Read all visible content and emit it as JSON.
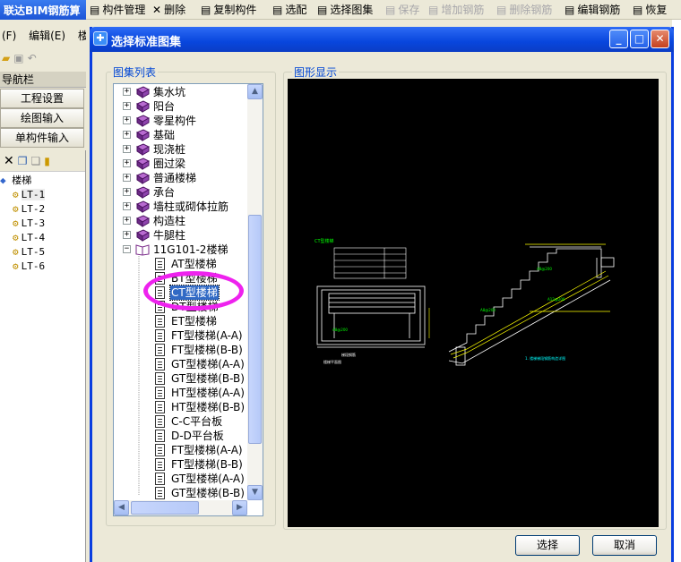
{
  "app": {
    "title": "联达BIM钢筋算",
    "menu": [
      "(F)",
      "编辑(E)",
      "楼"
    ],
    "toolbar": [
      {
        "label": "构件管理",
        "icon": "component-manage-icon",
        "disabled": false
      },
      {
        "label": "删除",
        "icon": "delete-x-icon",
        "disabled": false
      },
      {
        "label": "复制构件",
        "icon": "copy-component-icon",
        "disabled": false
      },
      {
        "label": "选配",
        "icon": "select-config-icon",
        "disabled": false
      },
      {
        "label": "选择图集",
        "icon": "select-atlas-icon",
        "disabled": false
      },
      {
        "label": "保存",
        "icon": "save-icon",
        "disabled": true
      },
      {
        "label": "增加钢筋",
        "icon": "add-rebar-icon",
        "disabled": true
      },
      {
        "label": "删除钢筋",
        "icon": "delete-rebar-icon",
        "disabled": true
      },
      {
        "label": "编辑钢筋",
        "icon": "edit-rebar-icon",
        "disabled": false
      },
      {
        "label": "恢复",
        "icon": "restore-icon",
        "disabled": false
      }
    ],
    "tree_peek": "楼梯",
    "nav_header": "导航栏",
    "nav_buttons": [
      "工程设置",
      "绘图输入",
      "单构件输入"
    ],
    "component_tree": {
      "root": "楼梯",
      "items": [
        "LT-1",
        "LT-2",
        "LT-3",
        "LT-4",
        "LT-5",
        "LT-6"
      ]
    }
  },
  "dialog": {
    "title": "选择标准图集",
    "list_label": "图集列表",
    "preview_label": "图形显示",
    "ok_button": "选择",
    "cancel_button": "取消",
    "tree": [
      {
        "label": "集水坑",
        "type": "book",
        "level": 0,
        "expanded": false
      },
      {
        "label": "阳台",
        "type": "book",
        "level": 0,
        "expanded": false
      },
      {
        "label": "零星构件",
        "type": "book",
        "level": 0,
        "expanded": false
      },
      {
        "label": "基础",
        "type": "book",
        "level": 0,
        "expanded": false
      },
      {
        "label": "现浇桩",
        "type": "book",
        "level": 0,
        "expanded": false
      },
      {
        "label": "圈过梁",
        "type": "book",
        "level": 0,
        "expanded": false
      },
      {
        "label": "普通楼梯",
        "type": "book",
        "level": 0,
        "expanded": false
      },
      {
        "label": "承台",
        "type": "book",
        "level": 0,
        "expanded": false
      },
      {
        "label": "墙柱或砌体拉筋",
        "type": "book",
        "level": 0,
        "expanded": false
      },
      {
        "label": "构造柱",
        "type": "book",
        "level": 0,
        "expanded": false
      },
      {
        "label": "牛腿柱",
        "type": "book",
        "level": 0,
        "expanded": false
      },
      {
        "label": "11G101-2楼梯",
        "type": "book-open",
        "level": 0,
        "expanded": true
      },
      {
        "label": "AT型楼梯",
        "type": "doc",
        "level": 1
      },
      {
        "label": "BT型楼梯",
        "type": "doc",
        "level": 1
      },
      {
        "label": "CT型楼梯",
        "type": "doc",
        "level": 1,
        "selected": true
      },
      {
        "label": "DT型楼梯",
        "type": "doc",
        "level": 1
      },
      {
        "label": "ET型楼梯",
        "type": "doc",
        "level": 1
      },
      {
        "label": "FT型楼梯(A-A)",
        "type": "doc",
        "level": 1
      },
      {
        "label": "FT型楼梯(B-B)",
        "type": "doc",
        "level": 1
      },
      {
        "label": "GT型楼梯(A-A)",
        "type": "doc",
        "level": 1
      },
      {
        "label": "GT型楼梯(B-B)",
        "type": "doc",
        "level": 1
      },
      {
        "label": "HT型楼梯(A-A)",
        "type": "doc",
        "level": 1
      },
      {
        "label": "HT型楼梯(B-B)",
        "type": "doc",
        "level": 1
      },
      {
        "label": "C-C平台板",
        "type": "doc",
        "level": 1
      },
      {
        "label": "D-D平台板",
        "type": "doc",
        "level": 1
      },
      {
        "label": "FT型楼梯(A-A)",
        "type": "doc",
        "level": 1
      },
      {
        "label": "FT型楼梯(B-B)",
        "type": "doc",
        "level": 1
      },
      {
        "label": "GT型楼梯(A-A)",
        "type": "doc",
        "level": 1
      },
      {
        "label": "GT型楼梯(B-B)",
        "type": "doc",
        "level": 1
      }
    ],
    "preview": {
      "drawing_title": "CT型楼梯",
      "background": "#000000",
      "line_color": "#ffffff",
      "accent_color": "#00ff00",
      "dimension_color": "#ffff00",
      "note_color": "#00ffff"
    }
  },
  "colors": {
    "titlebar": "#0846dd",
    "selection": "#316ac5",
    "annotation": "#ee22ee",
    "group_label": "#0046d5"
  }
}
